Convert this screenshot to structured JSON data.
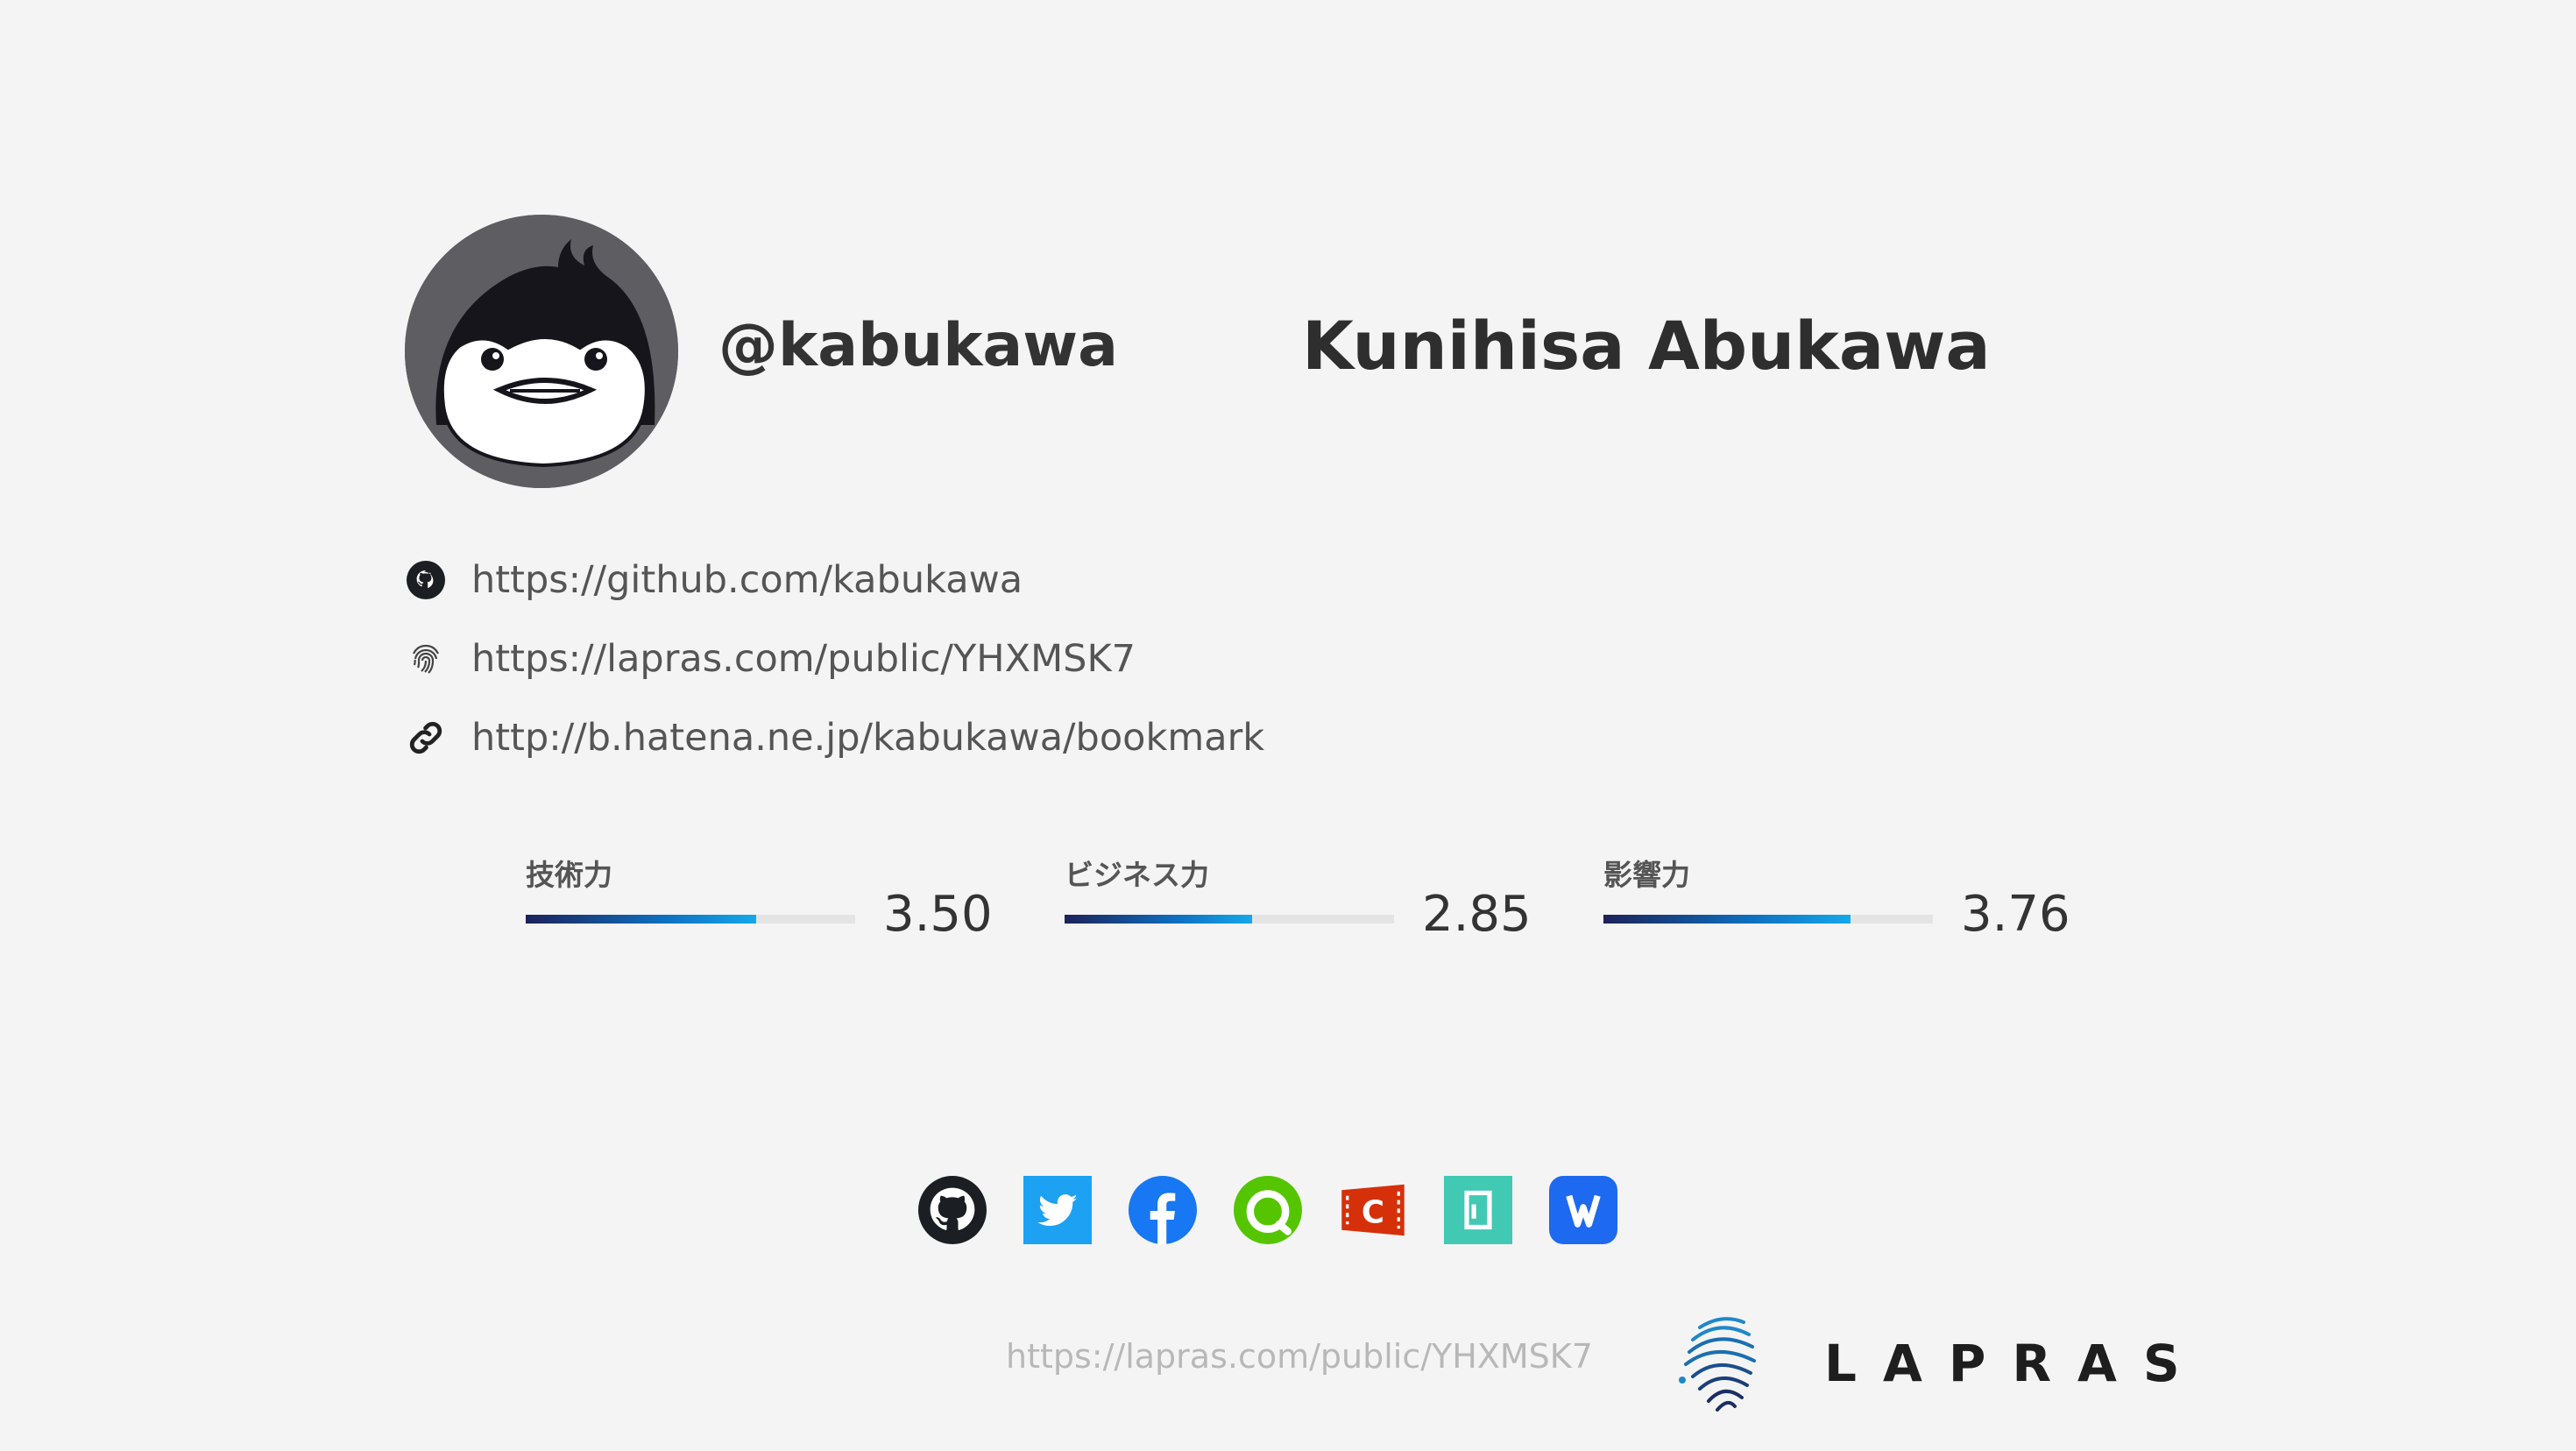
{
  "profile": {
    "handle": "@kabukawa",
    "name": "Kunihisa Abukawa",
    "avatar_icon": "penguin-avatar"
  },
  "links": [
    {
      "icon": "github-icon",
      "url": "https://github.com/kabukawa"
    },
    {
      "icon": "fingerprint-icon",
      "url": "https://lapras.com/public/YHXMSK7"
    },
    {
      "icon": "link-icon",
      "url": "http://b.hatena.ne.jp/kabukawa/bookmark"
    }
  ],
  "scores": [
    {
      "label": "技術力",
      "value": "3.50",
      "fraction": 0.7
    },
    {
      "label": "ビジネス力",
      "value": "2.85",
      "fraction": 0.57
    },
    {
      "label": "影響力",
      "value": "3.76",
      "fraction": 0.75
    }
  ],
  "socials": [
    "github-icon",
    "twitter-icon",
    "facebook-icon",
    "qiita-icon",
    "connpass-icon",
    "note-icon",
    "wantedly-icon"
  ],
  "footer": {
    "url": "https://lapras.com/public/YHXMSK7",
    "brand": "LAPRAS"
  },
  "colors": {
    "background": "#f4f4f4",
    "bar_dark": "#1d2159",
    "bar_light": "#15a8e8",
    "twitter": "#1da1f2",
    "facebook": "#1877f2",
    "qiita": "#55c500",
    "connpass": "#d6300a",
    "note": "#41c9b4",
    "wantedly": "#1d6af0"
  }
}
